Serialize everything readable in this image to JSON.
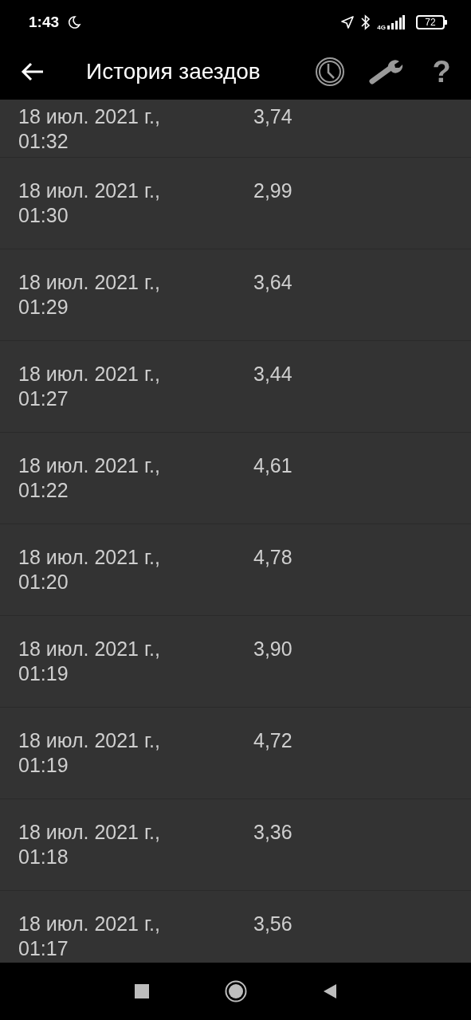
{
  "status_bar": {
    "time": "1:43",
    "network": "4G",
    "battery": "72"
  },
  "app_bar": {
    "title": "История заездов",
    "help": "?"
  },
  "rows": [
    {
      "datetime": "18 июл. 2021 г., 01:32",
      "value": "3,74"
    },
    {
      "datetime": "18 июл. 2021 г., 01:30",
      "value": "2,99"
    },
    {
      "datetime": "18 июл. 2021 г., 01:29",
      "value": "3,64"
    },
    {
      "datetime": "18 июл. 2021 г., 01:27",
      "value": "3,44"
    },
    {
      "datetime": "18 июл. 2021 г., 01:22",
      "value": "4,61"
    },
    {
      "datetime": "18 июл. 2021 г., 01:20",
      "value": "4,78"
    },
    {
      "datetime": "18 июл. 2021 г., 01:19",
      "value": "3,90"
    },
    {
      "datetime": "18 июл. 2021 г., 01:19",
      "value": "4,72"
    },
    {
      "datetime": "18 июл. 2021 г., 01:18",
      "value": "3,36"
    },
    {
      "datetime": "18 июл. 2021 г., 01:17",
      "value": "3,56"
    }
  ]
}
